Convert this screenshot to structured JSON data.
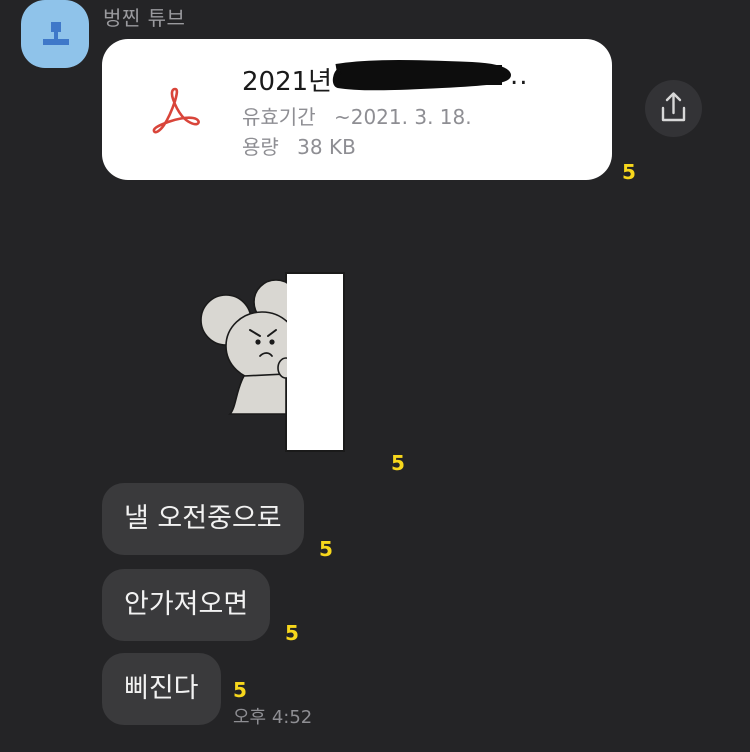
{
  "sender": {
    "name": "벙찐 튜브"
  },
  "file": {
    "name_prefix": "2021년",
    "name_suffix": "..",
    "expiry_label": "유효기간",
    "expiry_value": "~2021. 3. 18.",
    "size_label": "용량",
    "size_value": "38 KB",
    "icon": "pdf-acrobat-icon",
    "unread": "5"
  },
  "sticker": {
    "description_icon": "mouse-peeking-sticker",
    "unread": "5"
  },
  "messages": [
    {
      "text": "낼 오전중으로",
      "unread": "5"
    },
    {
      "text": "안가져오면",
      "unread": "5"
    },
    {
      "text": "삐진다",
      "unread": "5"
    }
  ],
  "timestamp": "오후 4:52",
  "colors": {
    "background": "#242426",
    "bubble": "#3a3a3c",
    "unread": "#f7d71c",
    "pdf_red": "#d9453a",
    "avatar": "#8fc3ea"
  }
}
